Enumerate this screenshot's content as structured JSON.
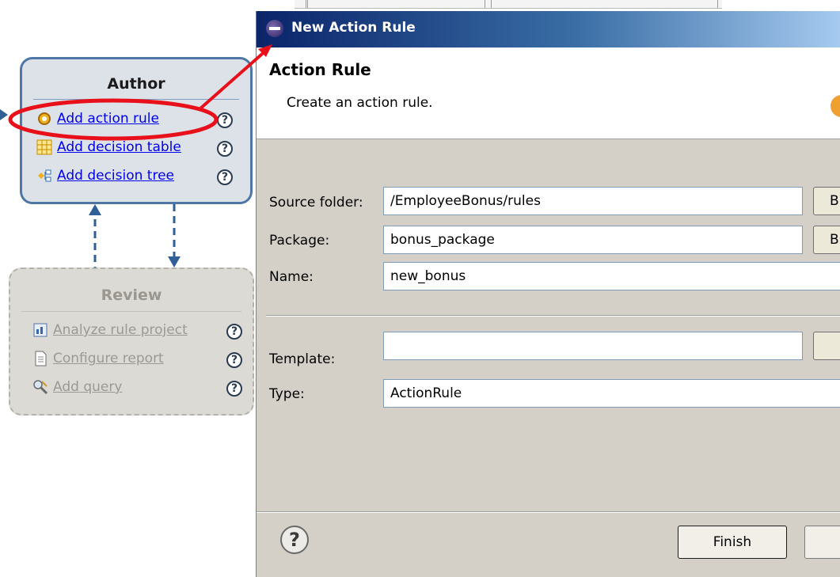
{
  "author": {
    "title": "Author",
    "items": [
      {
        "label": "Add action rule",
        "icon": "gear-icon"
      },
      {
        "label": "Add decision table",
        "icon": "table-icon"
      },
      {
        "label": "Add decision tree",
        "icon": "tree-icon"
      }
    ],
    "help": "?"
  },
  "review": {
    "title": "Review",
    "items": [
      {
        "label": "Analyze rule project",
        "icon": "report-icon"
      },
      {
        "label": "Configure report",
        "icon": "document-icon"
      },
      {
        "label": "Add query",
        "icon": "query-icon"
      }
    ],
    "help": "?"
  },
  "dialog": {
    "window_title": "New Action Rule",
    "header_title": "Action Rule",
    "header_desc": "Create an action rule.",
    "fields": {
      "source_folder": {
        "label": "Source folder:",
        "value": "/EmployeeBonus/rules"
      },
      "package": {
        "label": "Package:",
        "value": "bonus_package"
      },
      "name": {
        "label": "Name:",
        "value": "new_bonus"
      },
      "template": {
        "label": "Template:",
        "value": ""
      },
      "type": {
        "label": "Type:",
        "value": "ActionRule"
      }
    },
    "browse_label": "B",
    "help_glyph": "?",
    "finish_label": "Finish"
  },
  "colors": {
    "author_border": "#4f77a6",
    "annotation_red": "#e8101a",
    "link_blue": "#0000ee"
  }
}
